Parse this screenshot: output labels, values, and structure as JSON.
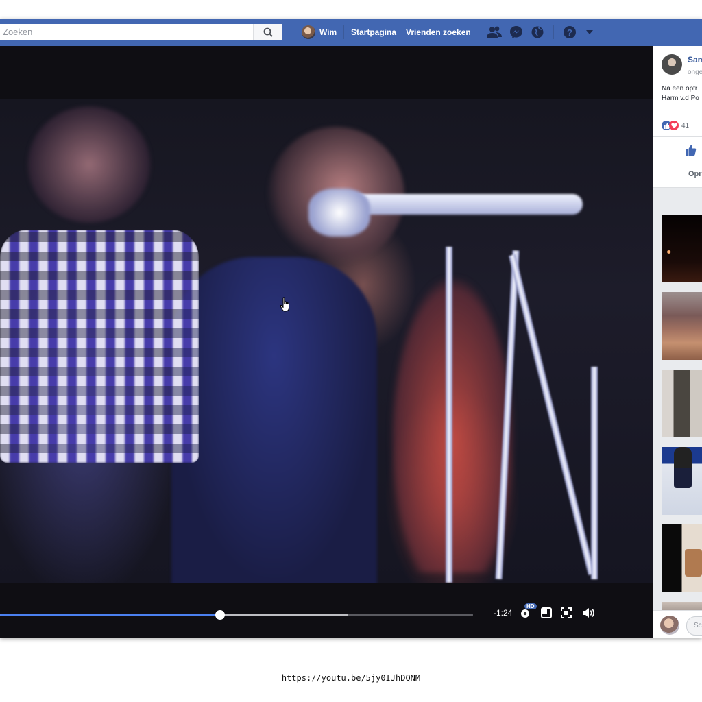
{
  "topbar": {
    "search_placeholder": "Zoeken",
    "user_name": "Wim",
    "home_label": "Startpagina",
    "find_friends_label": "Vrienden zoeken",
    "brand_color": "#4267b2"
  },
  "video": {
    "time_remaining": "-1:24",
    "hd_badge": "HD",
    "progress_played": 0.465,
    "progress_buffered": 0.736
  },
  "sidebar": {
    "post_author": "Sam",
    "post_subtitle": "onge",
    "post_text_line1": "Na een optr",
    "post_text_line2": "Harm v.d Po",
    "reaction_count": "41",
    "action_label": "Opr",
    "comment_placeholder": "Sc"
  },
  "footer": {
    "url": "https://youtu.be/5jy0IJhDQNM"
  }
}
